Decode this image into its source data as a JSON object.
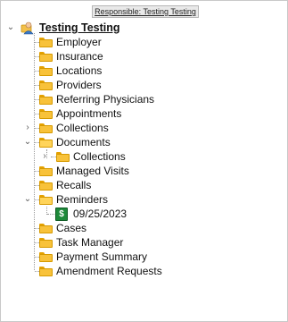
{
  "header": {
    "responsible_label": "Responsible: Testing Testing"
  },
  "tree": {
    "root": "Testing Testing",
    "items": {
      "employer": "Employer",
      "insurance": "Insurance",
      "locations": "Locations",
      "providers": "Providers",
      "referring": "Referring Physicians",
      "appointments": "Appointments",
      "collections": "Collections",
      "documents": "Documents",
      "documents_collections": "Collections",
      "managed_visits": "Managed Visits",
      "recalls": "Recalls",
      "reminders": "Reminders",
      "reminder_date": "09/25/2023",
      "cases": "Cases",
      "task_manager": "Task Manager",
      "payment_summary": "Payment Summary",
      "amendment_requests": "Amendment Requests"
    }
  },
  "icons": {
    "expander_expanded": "chevron-down-icon",
    "expander_collapsed": "chevron-right-icon",
    "folder": "folder-icon",
    "patient": "patient-icon",
    "reminder": "dollar-icon"
  },
  "colors": {
    "folder_fill": "#f8c23a",
    "folder_border": "#d69a00",
    "reminder_green": "#1e8a3a"
  }
}
